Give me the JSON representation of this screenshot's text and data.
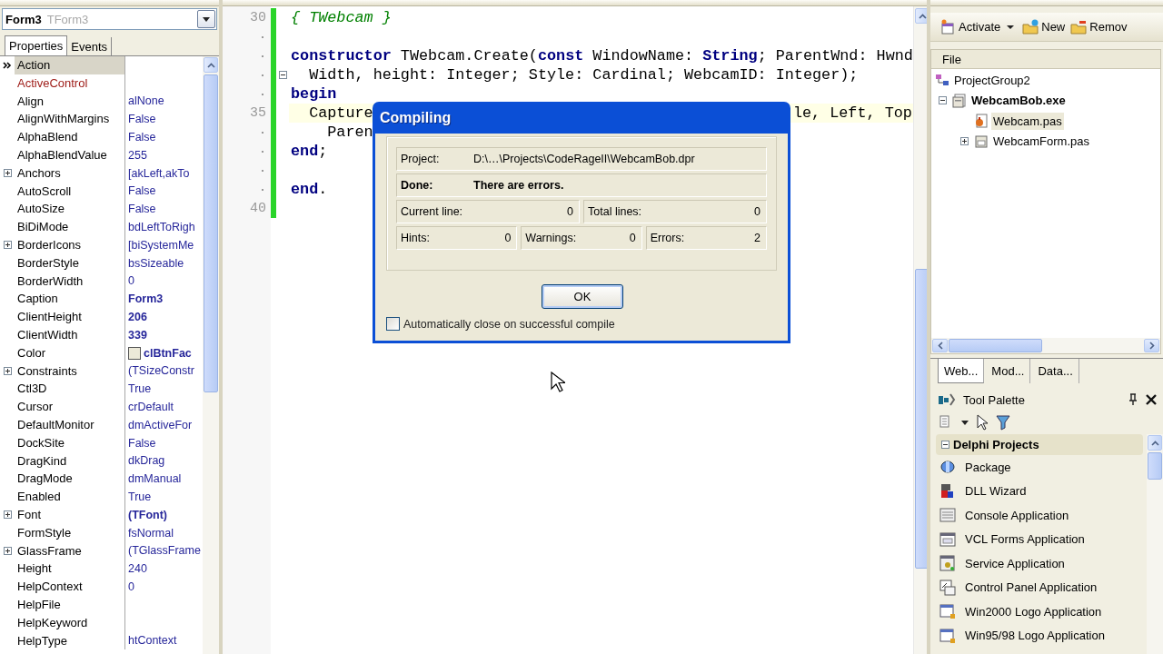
{
  "object_inspector": {
    "combo": {
      "name": "Form3",
      "type": "TForm3"
    },
    "tabs": [
      {
        "label": "Properties",
        "selected": true
      },
      {
        "label": "Events",
        "selected": false
      }
    ],
    "properties": [
      {
        "name": "Action",
        "selected": true,
        "linked": false
      },
      {
        "name": "ActiveControl",
        "selected": false,
        "linked": true
      },
      {
        "name": "Align",
        "value": "alNone",
        "selected": false,
        "bold": false,
        "linked": false
      },
      {
        "name": "AlignWithMargins",
        "value": "False",
        "selected": false,
        "bold": false,
        "linked": false
      },
      {
        "name": "AlphaBlend",
        "value": "False",
        "selected": false,
        "bold": false,
        "linked": false
      },
      {
        "name": "AlphaBlendValue",
        "value": "255",
        "selected": false,
        "bold": false,
        "linked": false
      },
      {
        "name": "Anchors",
        "value": "[akLeft,akTo",
        "selected": false,
        "expandable": true,
        "bold": false,
        "linked": false
      },
      {
        "name": "AutoScroll",
        "value": "False",
        "selected": false,
        "bold": false,
        "linked": false
      },
      {
        "name": "AutoSize",
        "value": "False",
        "selected": false,
        "bold": false,
        "linked": false
      },
      {
        "name": "BiDiMode",
        "value": "bdLeftToRigh",
        "selected": false,
        "bold": false,
        "linked": false
      },
      {
        "name": "BorderIcons",
        "value": "[biSystemMe",
        "selected": false,
        "expandable": true,
        "bold": false,
        "linked": false
      },
      {
        "name": "BorderStyle",
        "value": "bsSizeable",
        "selected": false,
        "bold": false,
        "linked": false
      },
      {
        "name": "BorderWidth",
        "value": "0",
        "selected": false,
        "bold": false,
        "linked": false
      },
      {
        "name": "Caption",
        "value": "Form3",
        "selected": false,
        "bold": true,
        "linked": false
      },
      {
        "name": "ClientHeight",
        "value": "206",
        "selected": false,
        "bold": true,
        "linked": false
      },
      {
        "name": "ClientWidth",
        "value": "339",
        "selected": false,
        "bold": true,
        "linked": false
      },
      {
        "name": "Color",
        "value": "clBtnFac",
        "selected": false,
        "bold": true,
        "linked": false,
        "color": "#ece9d8"
      },
      {
        "name": "Constraints",
        "value": "(TSizeConstr",
        "selected": false,
        "expandable": true,
        "bold": false,
        "linked": false
      },
      {
        "name": "Ctl3D",
        "value": "True",
        "selected": false,
        "bold": false,
        "linked": false
      },
      {
        "name": "Cursor",
        "value": "crDefault",
        "selected": false,
        "bold": false,
        "linked": false
      },
      {
        "name": "DefaultMonitor",
        "value": "dmActiveFor",
        "selected": false,
        "bold": false,
        "linked": false
      },
      {
        "name": "DockSite",
        "value": "False",
        "selected": false,
        "bold": false,
        "linked": false
      },
      {
        "name": "DragKind",
        "value": "dkDrag",
        "selected": false,
        "bold": false,
        "linked": false
      },
      {
        "name": "DragMode",
        "value": "dmManual",
        "selected": false,
        "bold": false,
        "linked": false
      },
      {
        "name": "Enabled",
        "value": "True",
        "selected": false,
        "bold": false,
        "linked": false
      },
      {
        "name": "Font",
        "value": "(TFont)",
        "selected": false,
        "expandable": true,
        "bold": true,
        "linked": false
      },
      {
        "name": "FormStyle",
        "value": "fsNormal",
        "selected": false,
        "bold": false,
        "linked": false
      },
      {
        "name": "GlassFrame",
        "value": "(TGlassFrame",
        "selected": false,
        "expandable": true,
        "bold": false,
        "linked": false
      },
      {
        "name": "Height",
        "value": "240",
        "selected": false,
        "bold": false,
        "linked": false
      },
      {
        "name": "HelpContext",
        "value": "0",
        "selected": false,
        "bold": false,
        "linked": false
      },
      {
        "name": "HelpFile",
        "selected": false,
        "linked": false
      },
      {
        "name": "HelpKeyword",
        "selected": false,
        "linked": false
      },
      {
        "name": "HelpType",
        "value": "htContext",
        "selected": false,
        "bold": false,
        "linked": false
      }
    ]
  },
  "editor": {
    "lines": [
      {
        "number": "30",
        "kind": "code",
        "tokens": [
          {
            "text": "{ TWebcam }",
            "kind": "comment"
          }
        ]
      },
      {
        "kind": "blank"
      },
      {
        "kind": "code",
        "tokens": [
          {
            "text": "constructor",
            "kind": "keyword"
          },
          {
            "text": " TWebcam.Create(",
            "kind": "plain"
          },
          {
            "text": "const",
            "kind": "keyword"
          },
          {
            "text": " WindowName: ",
            "kind": "plain"
          },
          {
            "text": "String",
            "kind": "keyword"
          },
          {
            "text": "; ParentWnd: Hwnd",
            "kind": "plain"
          }
        ]
      },
      {
        "kind": "code",
        "fold": true,
        "tokens": [
          {
            "text": "  Width, height: Integer; Style: Cardinal; WebcamID: Integer);",
            "kind": "plain"
          }
        ]
      },
      {
        "kind": "code",
        "tokens": [
          {
            "text": "begin",
            "kind": "keyword"
          }
        ]
      },
      {
        "number": "35",
        "kind": "code",
        "current": true,
        "tokens": [
          {
            "text": "  Capture",
            "kind": "plain"
          },
          {
            "text": "le, Left, Top",
            "kind": "plain",
            "covered_before": true
          }
        ]
      },
      {
        "kind": "code",
        "tokens": [
          {
            "text": "    Paren",
            "kind": "plain"
          }
        ]
      },
      {
        "kind": "code",
        "tokens": [
          {
            "text": "end",
            "kind": "keyword"
          },
          {
            "text": ";",
            "kind": "plain"
          }
        ]
      },
      {
        "kind": "blank"
      },
      {
        "kind": "code",
        "tokens": [
          {
            "text": "end",
            "kind": "keyword"
          },
          {
            "text": ".",
            "kind": "plain"
          }
        ]
      },
      {
        "number": "40",
        "kind": "blank"
      }
    ]
  },
  "dialog": {
    "title": "Compiling",
    "rows": [
      {
        "kind": "text",
        "bold": false,
        "cells": [
          {
            "label": "Project:",
            "value": "D:\\…\\Projects\\CodeRageII\\WebcamBob.dpr"
          }
        ]
      },
      {
        "kind": "text",
        "bold": true,
        "cells": [
          {
            "label": "Done:",
            "value": "There are errors."
          }
        ]
      },
      {
        "kind": "count",
        "bold": false,
        "cells": [
          {
            "label": "Current line:",
            "value": "0"
          },
          {
            "label": "Total lines:",
            "value": "0"
          }
        ]
      },
      {
        "kind": "count",
        "bold": false,
        "cells": [
          {
            "label": "Hints:",
            "value": "0"
          },
          {
            "label": "Warnings:",
            "value": "0"
          },
          {
            "label": "Errors:",
            "value": "2"
          }
        ]
      }
    ],
    "button": "OK",
    "checkbox": {
      "label": "Automatically close on successful compile",
      "checked": false
    }
  },
  "project_manager": {
    "toolbar": [
      {
        "label": "Activate",
        "kind": "activate"
      },
      {
        "label": "New",
        "kind": "new"
      },
      {
        "label": "Remov",
        "kind": "remove"
      }
    ],
    "header": "File",
    "tree": [
      {
        "label": "ProjectGroup2",
        "kind": "group",
        "bold": false,
        "selected": false,
        "children": [
          {
            "label": "WebcamBob.exe",
            "kind": "project",
            "bold": true,
            "selected": false,
            "expanded": true,
            "children": [
              {
                "label": "Webcam.pas",
                "kind": "unit",
                "bold": false,
                "selected": true
              },
              {
                "label": "WebcamForm.pas",
                "kind": "form",
                "bold": false,
                "selected": false,
                "expanded": false
              }
            ]
          }
        ]
      }
    ],
    "tabs": [
      {
        "label": "Web...",
        "selected": true
      },
      {
        "label": "Mod...",
        "selected": false
      },
      {
        "label": "Data...",
        "selected": false
      }
    ]
  },
  "tool_palette": {
    "title": "Tool Palette",
    "category": {
      "label": "Delphi Projects",
      "expanded": true
    },
    "items": [
      {
        "label": "Package",
        "kind": "package"
      },
      {
        "label": "DLL Wizard",
        "kind": "dll"
      },
      {
        "label": "Console Application",
        "kind": "console"
      },
      {
        "label": "VCL Forms Application",
        "kind": "vcl"
      },
      {
        "label": "Service Application",
        "kind": "service"
      },
      {
        "label": "Control Panel Application",
        "kind": "cpl"
      },
      {
        "label": "Win2000 Logo Application",
        "kind": "logo"
      },
      {
        "label": "Win95/98 Logo Application",
        "kind": "logo"
      }
    ]
  }
}
